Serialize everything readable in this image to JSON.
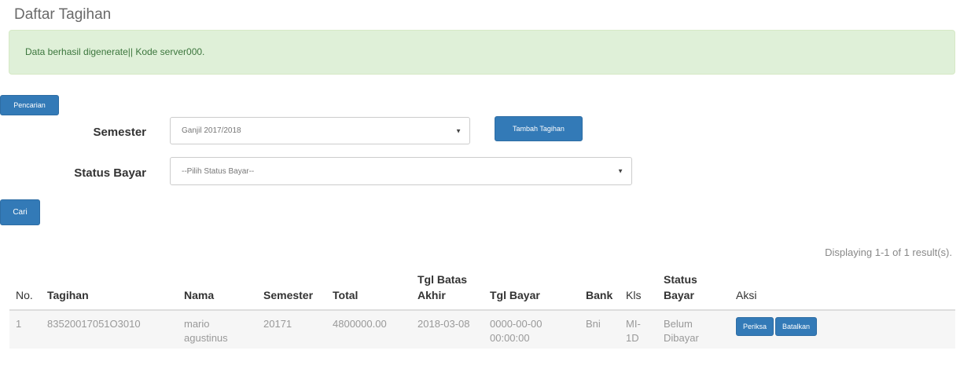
{
  "page": {
    "title": "Daftar Tagihan"
  },
  "alert": {
    "message": "Data berhasil digenerate|| Kode server000."
  },
  "buttons": {
    "pencarian": "Pencarian",
    "tambah_tagihan": "Tambah Tagihan",
    "cari": "Cari"
  },
  "form": {
    "semester_label": "Semester",
    "semester_value": "Ganjil 2017/2018",
    "status_bayar_label": "Status Bayar",
    "status_bayar_value": "--Pilih Status Bayar--"
  },
  "results_summary": "Displaying 1-1 of 1 result(s).",
  "table": {
    "headers": {
      "no": "No.",
      "tagihan": "Tagihan",
      "nama": "Nama",
      "semester": "Semester",
      "total": "Total",
      "tgl_batas_akhir": "Tgl Batas Akhir",
      "tgl_bayar": "Tgl Bayar",
      "bank": "Bank",
      "kls": "Kls",
      "status_bayar": "Status Bayar",
      "aksi": "Aksi"
    },
    "rows": [
      {
        "no": "1",
        "tagihan": "83520017051O3010",
        "nama": "mario agustinus",
        "semester": "20171",
        "total": "4800000.00",
        "tgl_batas_akhir": "2018-03-08",
        "tgl_bayar": "0000-00-00 00:00:00",
        "bank": "Bni",
        "kls": "MI-1D",
        "status_bayar": "Belum Dibayar",
        "aksi": {
          "periksa": "Periksa",
          "batalkan": "Batalkan"
        }
      }
    ]
  },
  "colors": {
    "primary": "#337ab7",
    "alert_bg": "#dff0d8",
    "alert_text": "#3c763d"
  }
}
